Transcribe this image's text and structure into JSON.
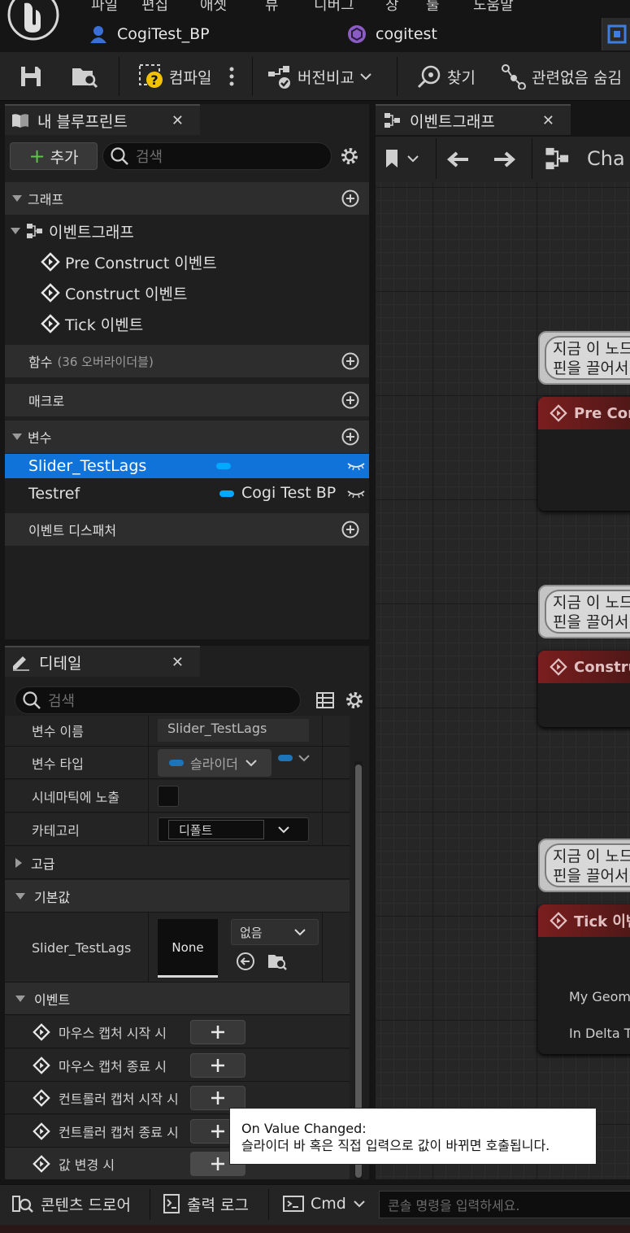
{
  "window": {
    "menu_fragments": [
      "파일",
      "편집",
      "애셋",
      "뷰",
      "디버그",
      "창",
      "툴",
      "도움말"
    ],
    "tabs": [
      {
        "label": "CogiTest_BP",
        "icon": "person-icon"
      },
      {
        "label": "cogitest",
        "icon": "widget-cube-icon"
      }
    ]
  },
  "toolbar": {
    "compile_label": "컴파일",
    "diff_label": "버전비교",
    "find_label": "찾기",
    "hide_unrelated_label": "관련없음 숨김"
  },
  "my_blueprint": {
    "tab_label": "내 블루프린트",
    "add_label": "추가",
    "search_placeholder": "검색",
    "sections": {
      "graphs": "그래프",
      "functions": "함수",
      "functions_count": "(36 오버라이더블)",
      "macros": "매크로",
      "variables": "변수",
      "dispatchers": "이벤트 디스패처"
    },
    "event_graph": {
      "label": "이벤트그래프",
      "events": [
        "Pre Construct 이벤트",
        "Construct 이벤트",
        "Tick 이벤트"
      ]
    },
    "variables": [
      {
        "name": "Slider_TestLags",
        "type": "",
        "selected": true
      },
      {
        "name": "Testref",
        "type": "Cogi Test BP",
        "selected": false
      }
    ]
  },
  "details": {
    "tab_label": "디테일",
    "search_placeholder": "검색",
    "rows": {
      "var_name_label": "변수 이름",
      "var_name_value": "Slider_TestLags",
      "var_type_label": "변수 타입",
      "var_type_value": "슬라이더",
      "cinematic_label": "시네마틱에 노출",
      "category_label": "카테고리",
      "category_value": "디폴트"
    },
    "advanced_label": "고급",
    "default_value": {
      "header": "기본값",
      "label": "Slider_TestLags",
      "thumb": "None",
      "dropdown": "없음"
    },
    "events_header": "이벤트",
    "events": [
      "마우스 캡처 시작 시",
      "마우스 캡처 종료 시",
      "컨트롤러 캡처 시작 시",
      "컨트롤러 캡처 종료 시",
      "값 변경 시"
    ]
  },
  "graph": {
    "tab_label": "이벤트그래프",
    "breadcrumb": "Cha",
    "comment_text_1": "지금 이 노드",
    "comment_text_2": "핀을 끌어서",
    "nodes": [
      {
        "title": "Pre Con"
      },
      {
        "title": "Constru"
      },
      {
        "title": "Tick 이벤"
      }
    ],
    "tick_pins": [
      "My Geom",
      "In Delta T"
    ]
  },
  "tooltip": {
    "title": "On Value Changed:",
    "body": "슬라이더 바 혹은 직접 입력으로 값이 바뀌면 호출됩니다."
  },
  "bottom": {
    "content_drawer": "콘텐츠 드로어",
    "output_log": "출력 로그",
    "cmd": "Cmd",
    "console_placeholder": "콘솔 명령을 입력하세요."
  },
  "colors": {
    "accent_selection": "#0f73d9",
    "variable_pin": "#00a8ff",
    "add_plus": "#5ec44e",
    "compile_warning": "#f2c200",
    "node_header_red": "#7a1e1e"
  }
}
